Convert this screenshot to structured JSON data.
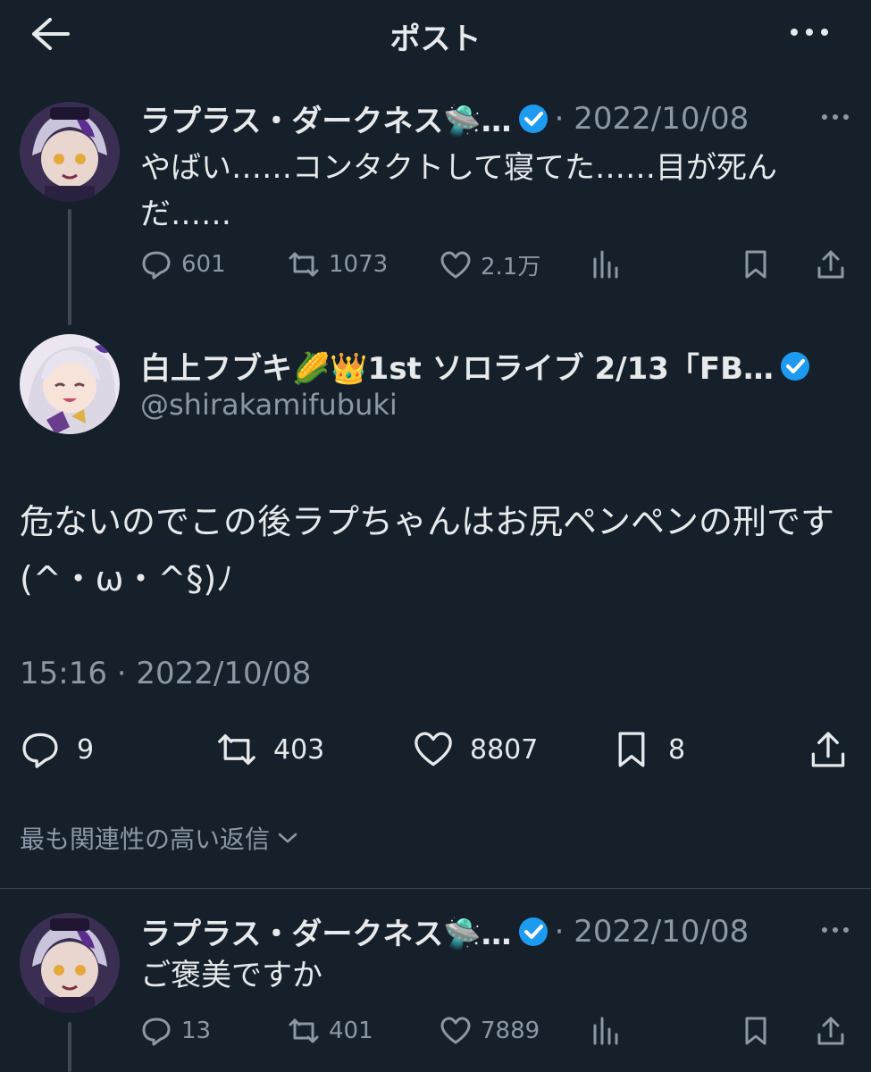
{
  "header": {
    "title": "ポスト"
  },
  "tweet1": {
    "name": "ラプラス・ダークネス🛸…",
    "date": "· 2022/10/08",
    "text": "やばい……コンタクトして寝てた……目が死んだ……",
    "counts": {
      "reply": "601",
      "retweet": "1073",
      "like": "2.1万"
    }
  },
  "main_tweet": {
    "name": "白上フブキ🌽👑1st ソロライブ 2/13「FB…",
    "handle": "@shirakamifubuki",
    "text": "危ないのでこの後ラプちゃんはお尻ペンペンの刑です(^・ω・^§)ﾉ",
    "timestamp": "15:16 · 2022/10/08",
    "counts": {
      "reply": "9",
      "retweet": "403",
      "like": "8807",
      "bookmark": "8"
    }
  },
  "sort": {
    "label": "最も関連性の高い返信"
  },
  "reply1": {
    "name": "ラプラス・ダークネス🛸…",
    "date": "· 2022/10/08",
    "text": "ご褒美ですか",
    "counts": {
      "reply": "13",
      "retweet": "401",
      "like": "7889"
    }
  },
  "colors": {
    "background": "#15202b",
    "text": "#e7e9ea",
    "muted": "#8b98a5",
    "verified": "#1d9bf0"
  }
}
